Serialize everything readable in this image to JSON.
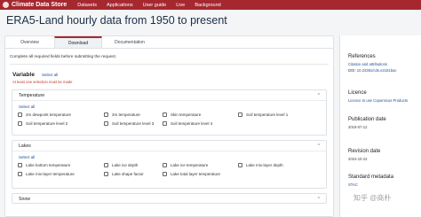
{
  "brand": {
    "name": "Climate Data Store",
    "logo_icon": "logo-circle-icon"
  },
  "nav": [
    "Datasets",
    "Applications",
    "User guide",
    "Live",
    "Background"
  ],
  "page_title": "ERA5-Land hourly data from 1950 to present",
  "tabs": [
    "Overview",
    "Download",
    "Documentation"
  ],
  "notice": "Complete all required fields before submitting the request.",
  "variable": {
    "title": "Variable",
    "select_all": "Select all",
    "required": "At least one selection must be made"
  },
  "temperature": {
    "title": "Temperature",
    "select_all": "Select all",
    "options": [
      "2m dewpoint temperature",
      "2m temperature",
      "Skin temperature",
      "Soil temperature level 1",
      "Soil temperature level 2",
      "Soil temperature level 3",
      "Soil temperature level 4"
    ]
  },
  "lakes": {
    "title": "Lakes",
    "select_all": "Select all",
    "options": [
      "Lake bottom temperature",
      "Lake ice depth",
      "Lake ice temperature",
      "Lake mix-layer depth",
      "Lake mix-layer temperature",
      "Lake shape factor",
      "Lake total layer temperature"
    ]
  },
  "snow": {
    "title": "Snow"
  },
  "sidebar": {
    "references": {
      "heading": "References",
      "link": "Citation and attributions",
      "doi_label": "DOI:",
      "doi": "10.24381/cds.e2161bac"
    },
    "licence": {
      "heading": "Licence",
      "link": "Licence to use Copernicus Products"
    },
    "publication_date": {
      "heading": "Publication date",
      "value": "2019-07-12"
    },
    "revision_date": {
      "heading": "Revision date",
      "value": "2024-10-24"
    },
    "metadata": {
      "heading": "Standard metadata",
      "stac_link": "STAC"
    }
  },
  "watermark": "知乎 @商朴"
}
